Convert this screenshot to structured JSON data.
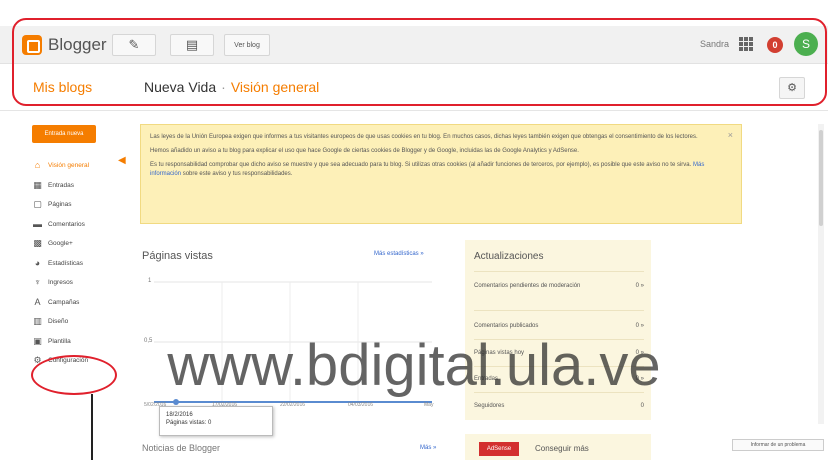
{
  "header": {
    "brand": "Blogger",
    "view_blog": "Ver blog",
    "user_name": "Sandra",
    "notification_count": "0",
    "avatar_initial": "S"
  },
  "subheader": {
    "my_blogs": "Mis blogs",
    "blog_name": "Nueva Vida",
    "separator": "·",
    "section": "Visión general"
  },
  "sidebar": {
    "new_entry": "Entrada nueva",
    "items": [
      {
        "label": "Visión general",
        "icon": "home-icon",
        "active": true
      },
      {
        "label": "Entradas",
        "icon": "posts-icon"
      },
      {
        "label": "Páginas",
        "icon": "pages-icon"
      },
      {
        "label": "Comentarios",
        "icon": "comments-icon"
      },
      {
        "label": "Google+",
        "icon": "google-plus-icon"
      },
      {
        "label": "Estadísticas",
        "icon": "stats-icon"
      },
      {
        "label": "Ingresos",
        "icon": "earnings-icon"
      },
      {
        "label": "Campañas",
        "icon": "campaigns-icon"
      },
      {
        "label": "Diseño",
        "icon": "layout-icon"
      },
      {
        "label": "Plantilla",
        "icon": "template-icon"
      },
      {
        "label": "Configuración",
        "icon": "settings-icon"
      }
    ]
  },
  "cookie_notice": {
    "p1": "Las leyes de la Unión Europea exigen que informes a tus visitantes europeos de que usas cookies en tu blog. En muchos casos, dichas leyes también exigen que obtengas el consentimiento de los lectores.",
    "p2": "Hemos añadido un aviso a tu blog para explicar el uso que hace Google de ciertas cookies de Blogger y de Google, incluidas las de Google Analytics y AdSense.",
    "p3": "Es tu responsabilidad comprobar que dicho aviso se muestre y que sea adecuado para tu blog. Si utilizas otras cookies (al añadir funciones de terceros, por ejemplo), es posible que este aviso no te sirva.",
    "p3_link": "Más información",
    "p3_end": "sobre este aviso y tus responsabilidades.",
    "close": "×"
  },
  "page_views": {
    "title": "Páginas vistas",
    "more_link": "Más estadísticas »",
    "y_top": "1",
    "y_mid": "0,5",
    "x_labels": [
      "5/02/2016",
      "17/02/2016",
      "22/02/2016",
      "04/03/2016",
      "May"
    ],
    "tooltip_date": "18/2/2016",
    "tooltip_value": "Páginas vistas: 0"
  },
  "stats": {
    "title": "Noticias de Blogger",
    "more_link": "Más »"
  },
  "updates": {
    "title": "Actualizaciones",
    "rows": [
      {
        "label": "Comentarios pendientes de moderación",
        "value": "0 »"
      },
      {
        "label": "Comentarios publicados",
        "value": "0 »"
      },
      {
        "label": "Páginas vistas hoy",
        "value": "0 »"
      },
      {
        "label": "Entradas",
        "value": "0 »"
      },
      {
        "label": "Seguidores",
        "value": "0"
      }
    ]
  },
  "earn": {
    "logo": "AdSense",
    "text": "Conseguir más"
  },
  "report_button": "Informar de un problema",
  "watermark": "www.bdigital.ula.ve",
  "colors": {
    "accent": "#f57d00",
    "annotation": "#e0202c",
    "notice_bg": "#fdf0b8",
    "updates_bg": "#fbf6df"
  }
}
